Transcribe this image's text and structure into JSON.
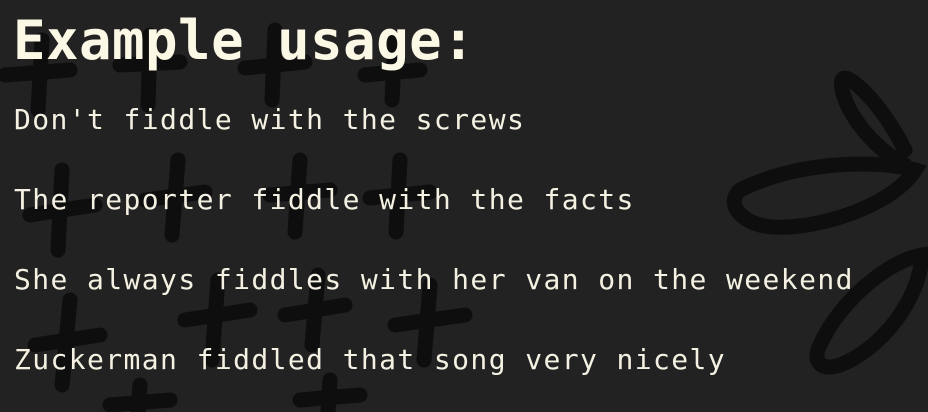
{
  "heading": "Example usage:",
  "examples": [
    "Don't fiddle with the screws",
    "The reporter fiddle with the facts",
    "She always fiddles with her van on the weekend",
    "Zuckerman fiddled that song very nicely"
  ],
  "colors": {
    "background": "#222222",
    "doodle": "#0e0e0e",
    "heading_text": "#fbf8e6",
    "body_text": "#f4f1e2"
  }
}
